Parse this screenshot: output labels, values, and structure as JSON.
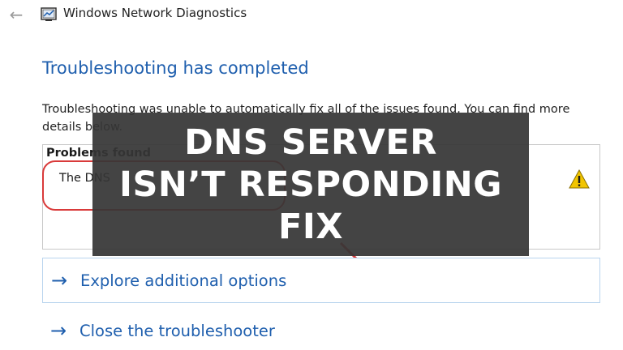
{
  "window": {
    "title": "Windows Network Diagnostics",
    "back_icon": "back-arrow-icon",
    "app_icon": "network-diagnostics-icon"
  },
  "content": {
    "heading": "Troubleshooting has completed",
    "description": "Troubleshooting was unable to automatically fix all of the issues found. You can find more details below.",
    "problems": {
      "header": "Problems found",
      "items": [
        {
          "text": "The DNS",
          "status_icon": "warning-icon"
        }
      ]
    },
    "options": [
      {
        "label": "Explore additional options",
        "icon": "arrow-right-icon"
      },
      {
        "label": "Close the troubleshooter",
        "icon": "arrow-right-icon"
      }
    ]
  },
  "overlay": {
    "lines": [
      "DNS SERVER",
      "ISN’T RESPONDING",
      "FIX"
    ]
  },
  "colors": {
    "accent": "#1f5fae",
    "highlight": "#d93a3a",
    "overlay_bg": "#363636",
    "warning": "#f2c500"
  }
}
